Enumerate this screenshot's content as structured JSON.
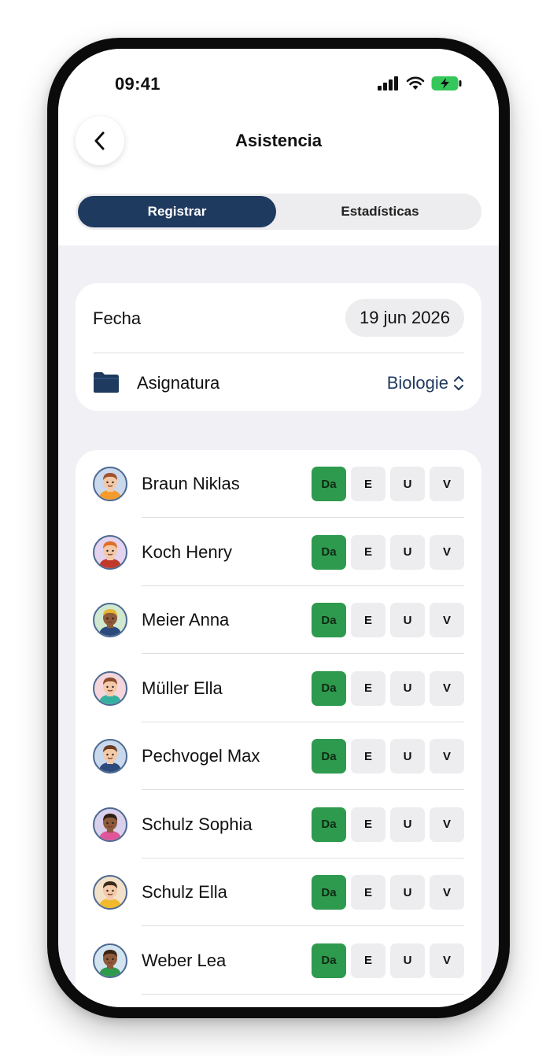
{
  "status_bar": {
    "time": "09:41"
  },
  "nav": {
    "title": "Asistencia"
  },
  "segments": {
    "active": "Registrar",
    "inactive": "Estadísticas"
  },
  "info": {
    "date_label": "Fecha",
    "date_value": "19 jun 2026",
    "subject_label": "Asignatura",
    "subject_value": "Biologie"
  },
  "attendance_options": [
    "Da",
    "E",
    "U",
    "V"
  ],
  "students": [
    {
      "name": "Braun Niklas",
      "selected": "Da",
      "avatar_bg": "#c9d8ec",
      "skin": "#f3c9a8",
      "hair": "#a0522d",
      "shirt": "#f39c2d"
    },
    {
      "name": "Koch Henry",
      "selected": "Da",
      "avatar_bg": "#e3d3ee",
      "skin": "#f3c9a8",
      "hair": "#e06f28",
      "shirt": "#c0392b"
    },
    {
      "name": "Meier Anna",
      "selected": "Da",
      "avatar_bg": "#cfe8cf",
      "skin": "#8d5a3b",
      "hair": "#e5b533",
      "shirt": "#2c4a7c"
    },
    {
      "name": "Müller Ella",
      "selected": "Da",
      "avatar_bg": "#f5d6dc",
      "skin": "#f3c9a8",
      "hair": "#8b4a2b",
      "shirt": "#35b0a0"
    },
    {
      "name": "Pechvogel Max",
      "selected": "Da",
      "avatar_bg": "#c9d8ec",
      "skin": "#f3c9a8",
      "hair": "#6b3e22",
      "shirt": "#2c4a7c"
    },
    {
      "name": "Schulz Sophia",
      "selected": "Da",
      "avatar_bg": "#d8d0ec",
      "skin": "#8d5a3b",
      "hair": "#2b1d14",
      "shirt": "#e0569a"
    },
    {
      "name": "Schulz Ella",
      "selected": "Da",
      "avatar_bg": "#f3e0c8",
      "skin": "#f3c9a8",
      "hair": "#3a2a1a",
      "shirt": "#f1b92c"
    },
    {
      "name": "Weber Lea",
      "selected": "Da",
      "avatar_bg": "#d3e4f1",
      "skin": "#8d5a3b",
      "hair": "#3a2414",
      "shirt": "#2e9a4e"
    }
  ],
  "colors": {
    "accent": "#1f3a5f",
    "present": "#2e9a4e",
    "chip": "#ededef"
  }
}
